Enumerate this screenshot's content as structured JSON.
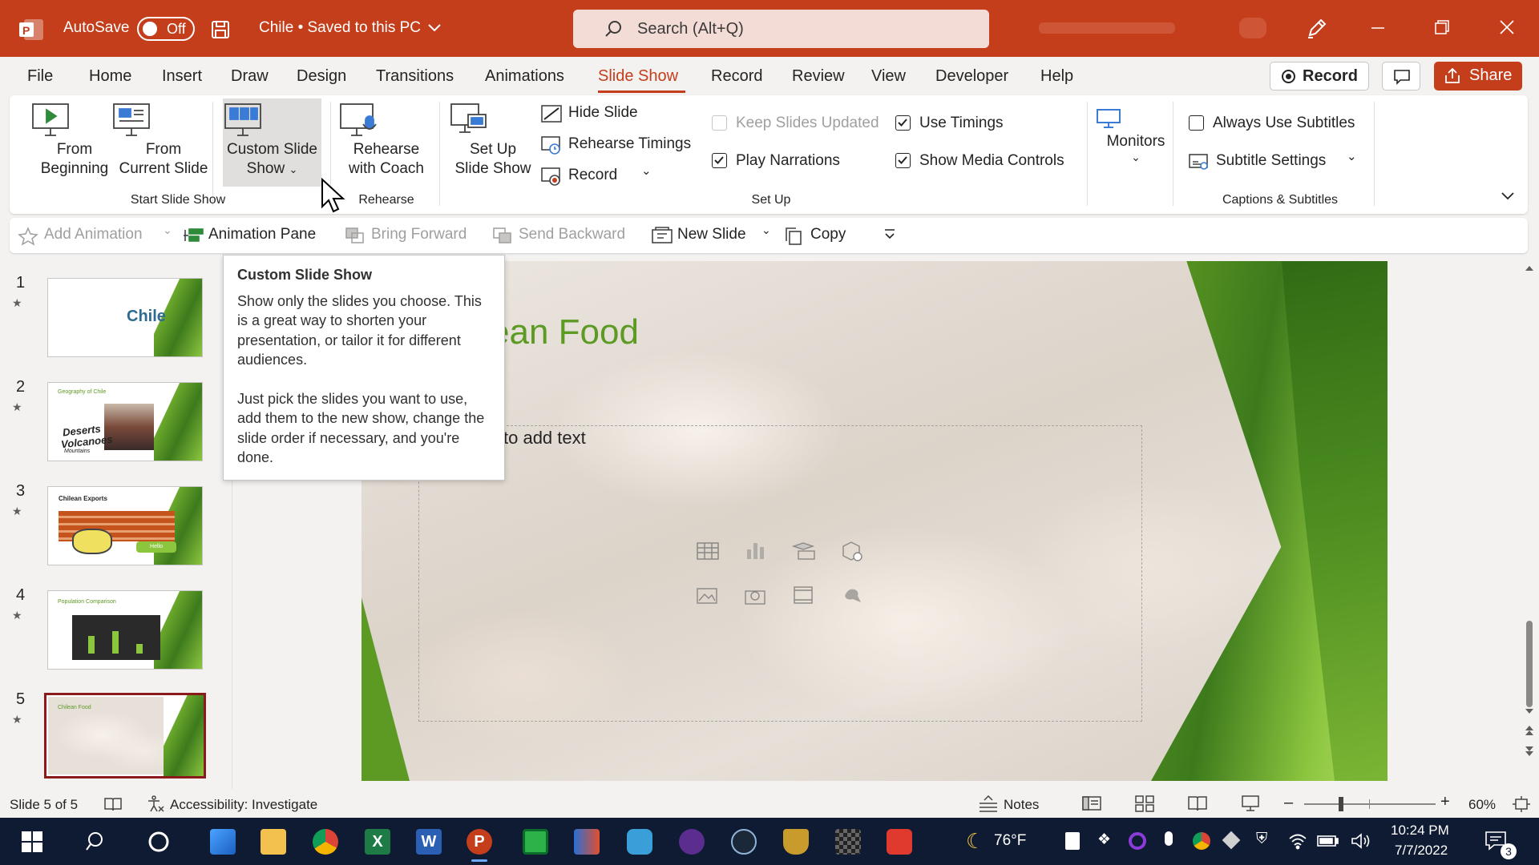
{
  "titlebar": {
    "autosave_label": "AutoSave",
    "autosave_state": "Off",
    "document_title": "Chile • Saved to this PC",
    "search_placeholder": "Search (Alt+Q)",
    "brand_color": "#c43e1c"
  },
  "menu": {
    "tabs": [
      "File",
      "Home",
      "Insert",
      "Draw",
      "Design",
      "Transitions",
      "Animations",
      "Slide Show",
      "Record",
      "Review",
      "View",
      "Developer",
      "Help"
    ],
    "active_tab": "Slide Show",
    "record_button": "Record",
    "share_button": "Share"
  },
  "ribbon": {
    "from_beginning": [
      "From",
      "Beginning"
    ],
    "from_current": [
      "From",
      "Current Slide"
    ],
    "custom_show": [
      "Custom Slide",
      "Show"
    ],
    "group_start": "Start Slide Show",
    "rehearse_coach": [
      "Rehearse",
      "with Coach"
    ],
    "group_rehearse": "Rehearse",
    "setup_show": [
      "Set Up",
      "Slide Show"
    ],
    "hide_slide": "Hide Slide",
    "rehearse_timings": "Rehearse Timings",
    "record": "Record",
    "keep_updated": "Keep Slides Updated",
    "play_narrations": "Play Narrations",
    "use_timings": "Use Timings",
    "show_media_controls": "Show Media Controls",
    "group_setup": "Set Up",
    "monitors": "Monitors",
    "always_subtitles": "Always Use Subtitles",
    "subtitle_settings": "Subtitle Settings",
    "group_captions": "Captions & Subtitles",
    "checks": {
      "keep_updated": false,
      "play_narrations": true,
      "use_timings": true,
      "show_media_controls": true,
      "always_subtitles": false
    }
  },
  "quickbar": {
    "add_animation": "Add Animation",
    "animation_pane": "Animation Pane",
    "bring_forward": "Bring Forward",
    "send_backward": "Send Backward",
    "new_slide": "New Slide",
    "copy": "Copy"
  },
  "slides": [
    {
      "num": "1",
      "title": "Chile"
    },
    {
      "num": "2",
      "title": "Geography of Chile"
    },
    {
      "num": "3",
      "title": "Chilean Exports"
    },
    {
      "num": "4",
      "title": "Population Comparison"
    },
    {
      "num": "5",
      "title": "Chilean Food"
    }
  ],
  "thumb_text": {
    "s2_words": [
      "Deserts",
      "Volcanoes",
      "Mountains"
    ],
    "s3_hello": "Hello"
  },
  "canvas": {
    "title_fragment": "ean Food",
    "body_fragment": "to add text"
  },
  "tooltip": {
    "title": "Custom Slide Show",
    "para1": "Show only the slides you choose. This is a great way to shorten your presentation, or tailor it for different audiences.",
    "para2": "Just pick the slides you want to use, add them to the new show, change the slide order if necessary, and you're done."
  },
  "status": {
    "slide_indicator": "Slide 5 of 5",
    "accessibility": "Accessibility: Investigate",
    "notes": "Notes",
    "zoom": "60%",
    "zoom_level": 0.6
  },
  "taskbar": {
    "weather": "76°F",
    "time": "10:24 PM",
    "date": "7/7/2022",
    "notifications": "3"
  }
}
